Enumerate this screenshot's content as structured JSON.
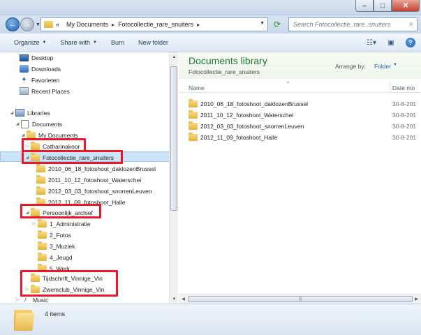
{
  "address": {
    "prefix": "«",
    "crumbs": [
      "My Documents",
      "Fotocollectie_rare_snuiters"
    ],
    "search_placeholder": "Search Fotocollectie_rare_snuiters"
  },
  "toolbar": {
    "organize": "Organize",
    "share_with": "Share with",
    "burn": "Burn",
    "new_folder": "New folder"
  },
  "nav": {
    "desktop": "Desktop",
    "downloads": "Downloads",
    "favorieten": "Favorieten",
    "recent_places": "Recent Places",
    "libraries": "Libraries",
    "documents": "Documents",
    "my_documents": "My Documents",
    "catharinakoor": "Catharinakoor",
    "fotocollectie": "Fotocollectie_rare_snuiters",
    "foto_children": [
      "2010_06_18_fotoshoot_daklozenBrussel",
      "2011_10_12_fotoshoot_Waterschei",
      "2012_03_03_fotoshoot_snorrenLeuven",
      "2012_11_09_fotoshoot_Halle"
    ],
    "persoonlijk": "Persoonlijk_archief",
    "persoonlijk_children": [
      "1_Administratie",
      "2_Fotos",
      "3_Muziek",
      "4_Jeugd",
      "5_Werk"
    ],
    "tijdschrift": "Tijdschrift_Vinnige_Vin",
    "zwemclub": "Zwemclub_Vinnige_Vin",
    "music": "Music"
  },
  "content": {
    "library_title": "Documents library",
    "library_subtitle": "Fotocollectie_rare_snuiters",
    "arrange_label": "Arrange by:",
    "arrange_value": "Folder",
    "col_name": "Name",
    "col_date": "Date mo",
    "files": [
      {
        "name": "2010_06_18_fotoshoot_daklozenBrussel",
        "date": "30-8-201"
      },
      {
        "name": "2011_10_12_fotoshoot_Waterschei",
        "date": "30-8-201"
      },
      {
        "name": "2012_03_03_fotoshoot_snorrenLeuven",
        "date": "30-8-201"
      },
      {
        "name": "2012_11_09_fotoshoot_Halle",
        "date": "30-8-201"
      }
    ]
  },
  "status": {
    "item_count": "4 items"
  }
}
